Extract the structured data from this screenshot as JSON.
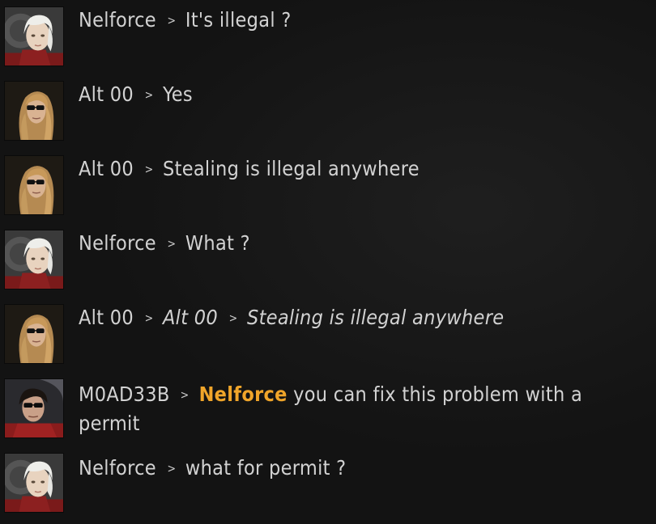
{
  "messages": [
    {
      "sender": "Nelforce",
      "avatar": "nelforce",
      "text": "It's illegal ?"
    },
    {
      "sender": "Alt 00",
      "avatar": "alt00",
      "text": "Yes"
    },
    {
      "sender": "Alt 00",
      "avatar": "alt00",
      "text": "Stealing is illegal anywhere"
    },
    {
      "sender": "Nelforce",
      "avatar": "nelforce",
      "text": "What ?"
    },
    {
      "sender": "Alt 00",
      "avatar": "alt00",
      "quoted_sender": "Alt 00",
      "text": "Stealing is illegal anywhere"
    },
    {
      "sender": "M0AD33B",
      "avatar": "m0ad33b",
      "mention": "Nelforce",
      "text_line1": "you can fix this problem with a",
      "text_line2": "permit"
    },
    {
      "sender": "Nelforce",
      "avatar": "nelforce",
      "text": "what for permit ?"
    }
  ],
  "separator": ">",
  "colors": {
    "background": "#131313",
    "text": "#d2d2d2",
    "mention": "#f0a52a"
  },
  "icons": {
    "nelforce": "portrait-white-hair-icon",
    "alt00": "portrait-blonde-sunglasses-icon",
    "m0ad33b": "portrait-dark-hair-sunglasses-icon"
  }
}
